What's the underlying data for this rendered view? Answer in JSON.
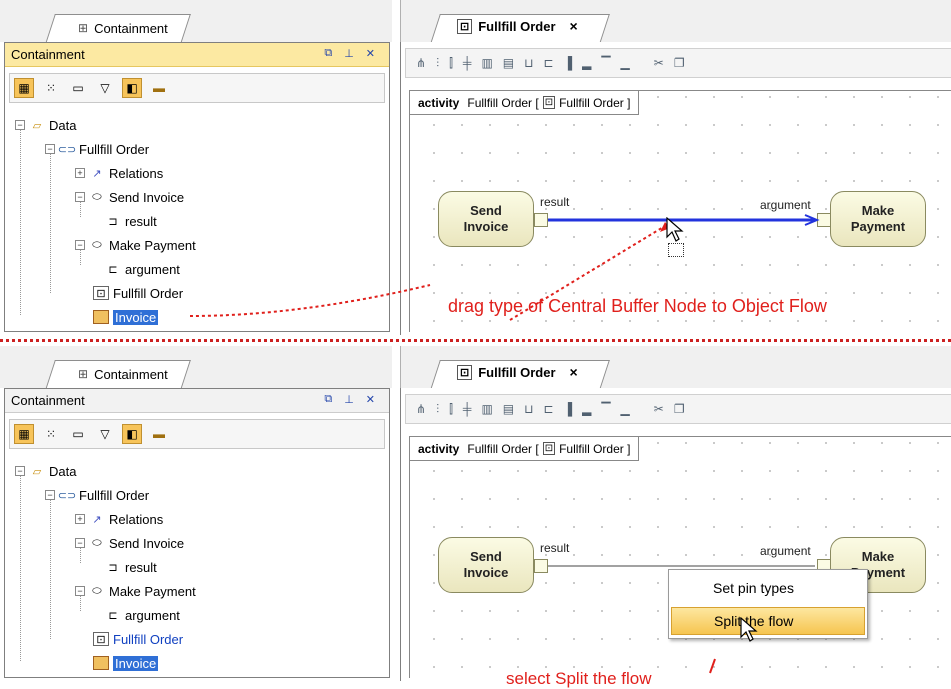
{
  "containment_tab_label": "Containment",
  "containment_header": "Containment",
  "tree": {
    "data": "Data",
    "fullfill_order": "Fullfill Order",
    "relations": "Relations",
    "send_invoice": "Send Invoice",
    "result": "result",
    "make_payment": "Make Payment",
    "argument": "argument",
    "fullfill_order_diagram": "Fullfill Order",
    "invoice": "Invoice"
  },
  "diagram_tab_label": "Fullfill Order",
  "diagram_tab_close": "×",
  "frame": {
    "keyword": "activity",
    "name": "Fullfill Order [",
    "ref": "Fullfill Order ]"
  },
  "actions": {
    "send_invoice": "Send Invoice",
    "make_payment": "Make Payment"
  },
  "pins": {
    "result": "result",
    "argument": "argument"
  },
  "annotations": {
    "top": "drag type of Central Buffer Node to Object Flow",
    "bottom": "select Split the flow"
  },
  "context_menu": {
    "item1": "Set pin types",
    "item2": "Split the flow"
  },
  "colors": {
    "selection": "#2f6fd6",
    "annotation": "#e0201c",
    "flow_highlight": "#2233dd"
  },
  "icons": {
    "header": [
      "restore-icon",
      "pin-icon",
      "close-icon"
    ],
    "toolbar": [
      "layout-icon",
      "brackets-icon",
      "bar-icon",
      "filter-icon",
      "module-icon",
      "folder-icon"
    ]
  }
}
